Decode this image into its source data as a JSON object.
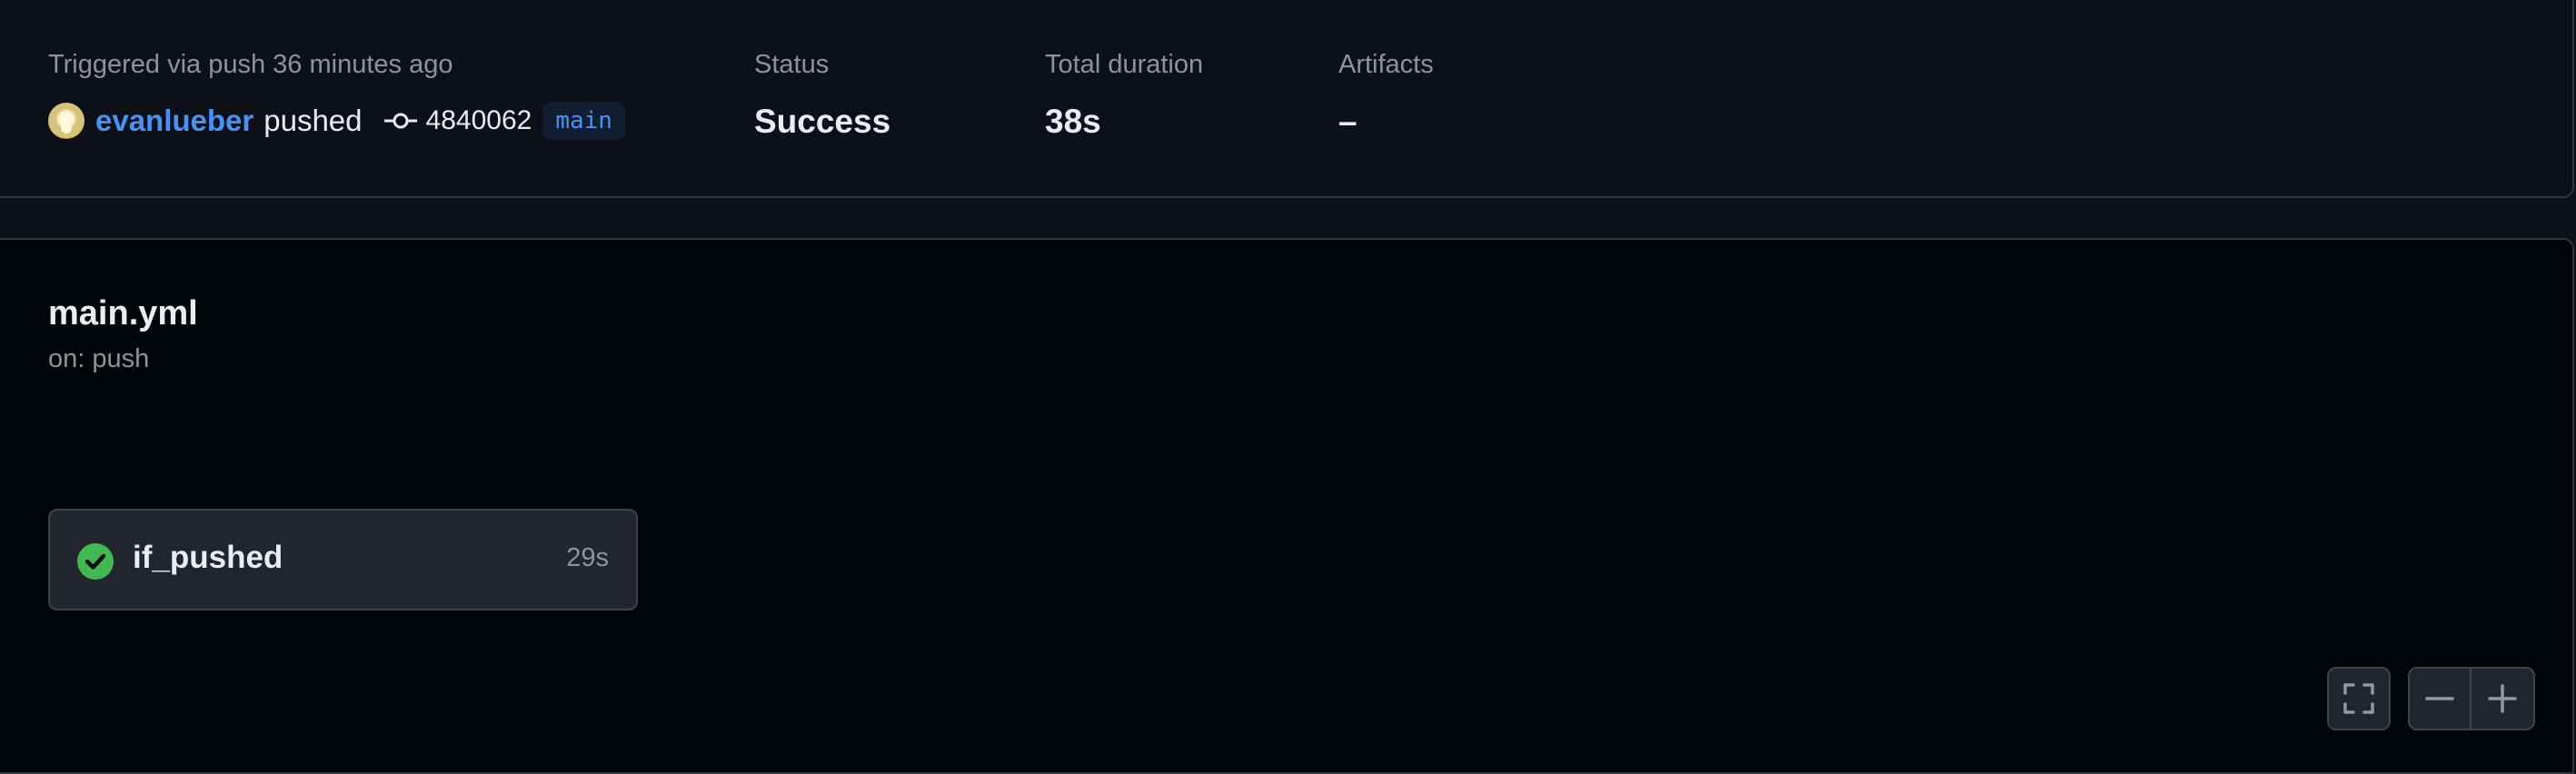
{
  "summary": {
    "trigger_text": "Triggered via push 36 minutes ago",
    "actor": "evanlueber",
    "action": "pushed",
    "commit_sha": "4840062",
    "branch": "main",
    "status_label": "Status",
    "status_value": "Success",
    "duration_label": "Total duration",
    "duration_value": "38s",
    "artifacts_label": "Artifacts",
    "artifacts_value": "–"
  },
  "workflow": {
    "file": "main.yml",
    "trigger": "on: push",
    "jobs": [
      {
        "name": "if_pushed",
        "duration": "29s",
        "status": "success"
      }
    ]
  },
  "controls": {
    "fullscreen_icon": "fullscreen-icon",
    "zoom_out_icon": "zoom-out-icon",
    "zoom_in_icon": "zoom-in-icon"
  },
  "colors": {
    "accent": "#4493f8",
    "success": "#3fb950",
    "background": "#0d1117",
    "canvas": "#010409"
  }
}
